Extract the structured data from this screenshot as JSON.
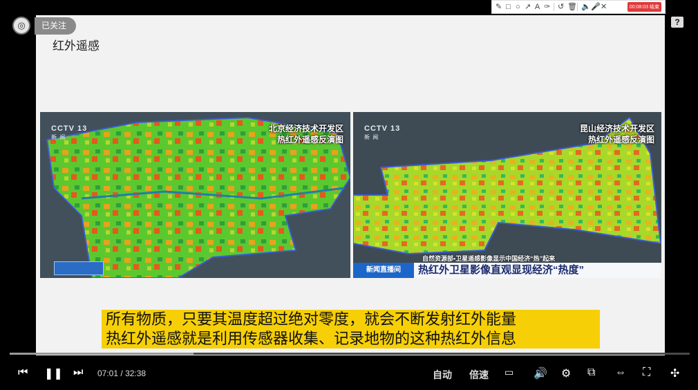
{
  "toolbar": {
    "recording": "00:08:03 结束",
    "tools": [
      "✎",
      "□",
      "○",
      "↗",
      "A",
      "✑",
      "↺",
      "🗑",
      "🔈",
      "🎤",
      "✕"
    ]
  },
  "course": {
    "follow_label": "已关注",
    "help": "?"
  },
  "slide": {
    "title": "红外遥感"
  },
  "left_image": {
    "channel": "CCTV 13",
    "channel_sub": "新 闻",
    "caption_line1": "北京经济技术开发区",
    "caption_line2": "热红外遥感反演图"
  },
  "right_image": {
    "channel": "CCTV 13",
    "channel_sub": "新 闻",
    "caption_line1": "昆山经济技术开发区",
    "caption_line2": "热红外遥感反演图",
    "ticker_sub": "自然资源部•卫星遥感影像显示中国经济“热”起来",
    "ticker_tag": "新闻直播间",
    "ticker_main": "热红外卫星影像直观显现经济“热度”"
  },
  "subtitles": {
    "line1": "所有物质，只要其温度超过绝对零度，就会不断发射红外能量",
    "line2": "热红外遥感就是利用传感器收集、记录地物的这种热红外信息"
  },
  "player": {
    "current_time": "07:01",
    "separator": "/",
    "duration": "32:38",
    "progress": 0.215,
    "buffered": 0.27,
    "auto_label": "自动",
    "speed_label": "倍速"
  },
  "colors": {
    "accent": "#2e8ff0",
    "subtitle_bg": "#f6cf07"
  }
}
